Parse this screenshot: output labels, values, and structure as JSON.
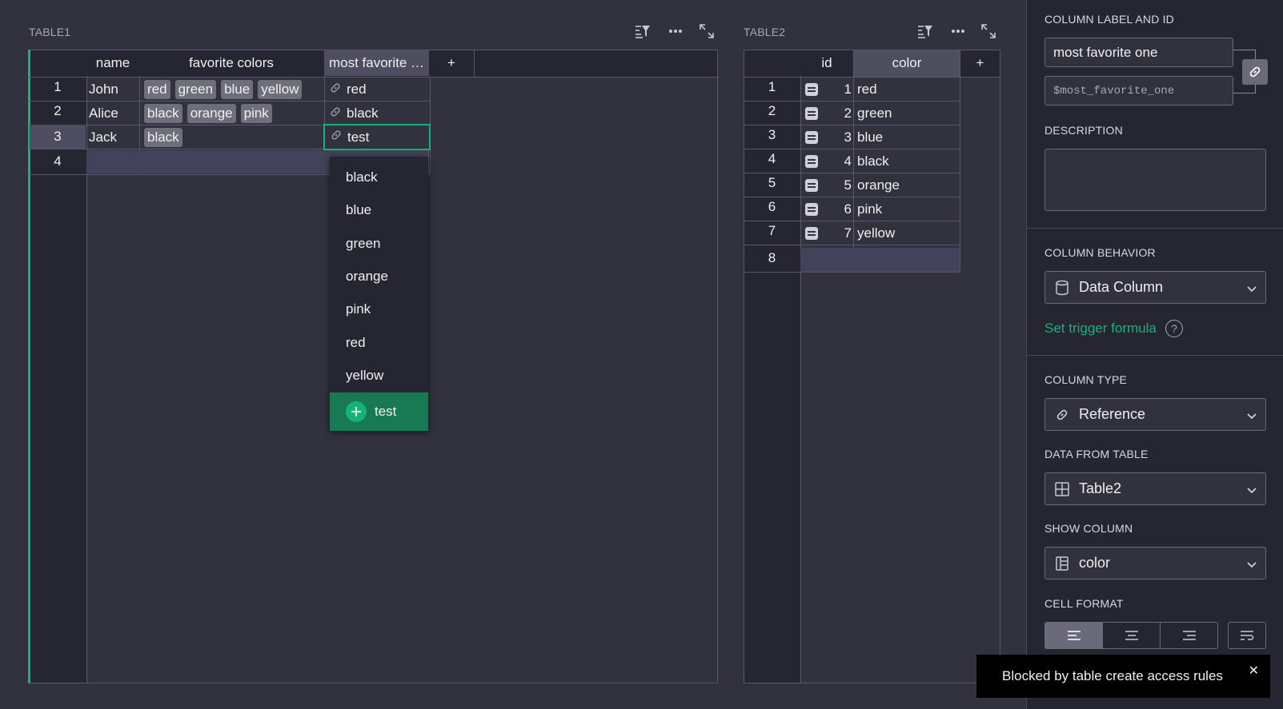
{
  "table1": {
    "title": "TABLE1",
    "columns": [
      "name",
      "favorite colors",
      "most favorite …",
      "+"
    ],
    "rows": [
      {
        "num": "1",
        "name": "John",
        "colors": [
          "red",
          "green",
          "blue",
          "yellow"
        ],
        "ref": "red"
      },
      {
        "num": "2",
        "name": "Alice",
        "colors": [
          "black",
          "orange",
          "pink"
        ],
        "ref": "black"
      },
      {
        "num": "3",
        "name": "Jack",
        "colors": [
          "black"
        ],
        "ref": "test"
      },
      {
        "num": "4",
        "name": "",
        "colors": [],
        "ref": ""
      }
    ]
  },
  "dropdown": {
    "items": [
      "black",
      "blue",
      "green",
      "orange",
      "pink",
      "red",
      "yellow"
    ],
    "add_label": "test"
  },
  "table2": {
    "title": "TABLE2",
    "columns": [
      "id",
      "color",
      "+"
    ],
    "rows": [
      {
        "num": "1",
        "id": "1",
        "color": "red"
      },
      {
        "num": "2",
        "id": "2",
        "color": "green"
      },
      {
        "num": "3",
        "id": "3",
        "color": "blue"
      },
      {
        "num": "4",
        "id": "4",
        "color": "black"
      },
      {
        "num": "5",
        "id": "5",
        "color": "orange"
      },
      {
        "num": "6",
        "id": "6",
        "color": "pink"
      },
      {
        "num": "7",
        "id": "7",
        "color": "yellow"
      },
      {
        "num": "8",
        "id": "",
        "color": ""
      }
    ]
  },
  "panel": {
    "label_section": "COLUMN LABEL AND ID",
    "label_value": "most favorite one",
    "id_value": "$most_favorite_one",
    "description_section": "DESCRIPTION",
    "behavior_section": "COLUMN BEHAVIOR",
    "behavior_value": "Data Column",
    "trigger_link": "Set trigger formula",
    "help_glyph": "?",
    "type_section": "COLUMN TYPE",
    "type_value": "Reference",
    "from_table_section": "DATA FROM TABLE",
    "from_table_value": "Table2",
    "show_column_section": "SHOW COLUMN",
    "show_column_value": "color",
    "cell_format_section": "CELL FORMAT"
  },
  "toast": {
    "message": "Blocked by table create access rules",
    "close": "✕"
  },
  "colors": {
    "accent": "#16b378",
    "dropdown_add_bg": "#177a54",
    "background": "#32323f",
    "header_bg": "#262633"
  }
}
